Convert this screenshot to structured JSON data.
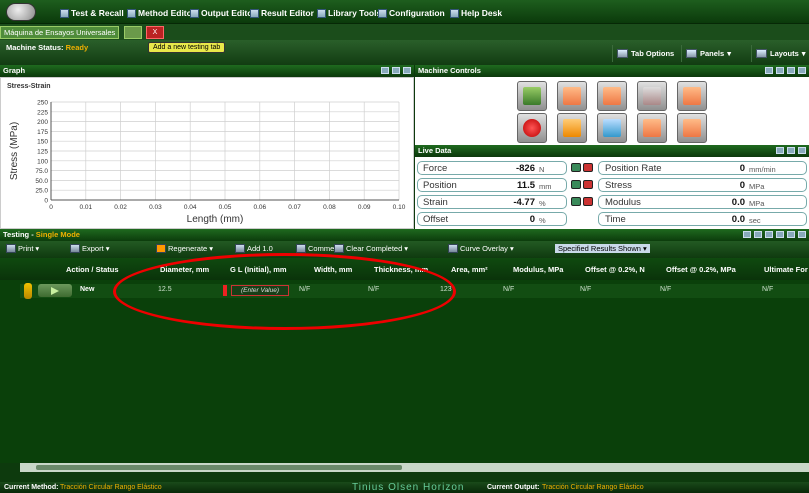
{
  "menubar": {
    "items": [
      "Test & Recall",
      "Method Editor",
      "Output Editor",
      "Result Editor",
      "Library Tools",
      "Configuration",
      "Help Desk"
    ]
  },
  "tabs": {
    "main": "Máquina de Ensayos Universales",
    "close": "X",
    "tooltip": "Add a new testing tab"
  },
  "status": {
    "label": "Machine Status:",
    "value": "Ready"
  },
  "top_buttons": {
    "tab_options": "Tab Options",
    "panels": "Panels",
    "layouts": "Layouts"
  },
  "graph": {
    "panel_title": "Graph",
    "chart_data": {
      "type": "line",
      "title": "Stress-Strain",
      "xlabel": "Length (mm)",
      "ylabel": "Stress (MPa)",
      "xlim": [
        0,
        0.1
      ],
      "ylim": [
        0,
        250
      ],
      "x_ticks": [
        "0",
        "0.01",
        "0.02",
        "0.03",
        "0.04",
        "0.05",
        "0.06",
        "0.07",
        "0.08",
        "0.09",
        "0.10"
      ],
      "y_ticks": [
        "0",
        "25.0",
        "50.0",
        "75.0",
        "100",
        "125",
        "150",
        "175",
        "200",
        "225",
        "250"
      ],
      "series": [],
      "grid": true
    }
  },
  "machine_controls": {
    "title": "Machine Controls"
  },
  "live_data": {
    "title": "Live Data",
    "rows": [
      {
        "label": "Force",
        "value": "-826",
        "unit": "N"
      },
      {
        "label": "Position",
        "value": "11.5",
        "unit": "mm"
      },
      {
        "label": "Strain",
        "value": "-4.77",
        "unit": "%"
      },
      {
        "label": "Offset",
        "value": "0",
        "unit": "%"
      },
      {
        "label": "Position Rate",
        "value": "0",
        "unit": "mm/min"
      },
      {
        "label": "Stress",
        "value": "0",
        "unit": "MPa"
      },
      {
        "label": "Modulus",
        "value": "0.0",
        "unit": "MPa"
      },
      {
        "label": "Time",
        "value": "0.0",
        "unit": "sec"
      }
    ]
  },
  "testing": {
    "title": "Testing - ",
    "mode": "Single Mode",
    "toolbar": [
      "Print",
      "Export",
      "Regenerate",
      "Add 1.0",
      "Comments",
      "Clear Completed",
      "Curve Overlay",
      "Specified Results Shown"
    ],
    "columns": [
      "Action / Status",
      "Diameter, mm",
      "G L (Initial), mm",
      "Width, mm",
      "Thickness, mm",
      "Area, mm²",
      "Modulus, MPa",
      "Offset @ 0.2%, N",
      "Offset @ 0.2%, MPa",
      "Ultimate For"
    ],
    "row": {
      "status": "New",
      "diameter": "12.5",
      "gl": "(Enter Value)",
      "width": "N/F",
      "thickness": "N/F",
      "area": "123",
      "modulus": "N/F",
      "offset_n": "N/F",
      "offset_mpa": "N/F",
      "ultimate": "N/F"
    }
  },
  "footer": {
    "method_label": "Current Method:",
    "method": "Tracción Circular Rango Elástico",
    "brand": "Tinius Olsen Horizon",
    "output_label": "Current Output:",
    "output": "Tracción Circular Rango Elástico"
  },
  "colors": {
    "accent": "#f0b000",
    "annotation": "#e00000"
  }
}
